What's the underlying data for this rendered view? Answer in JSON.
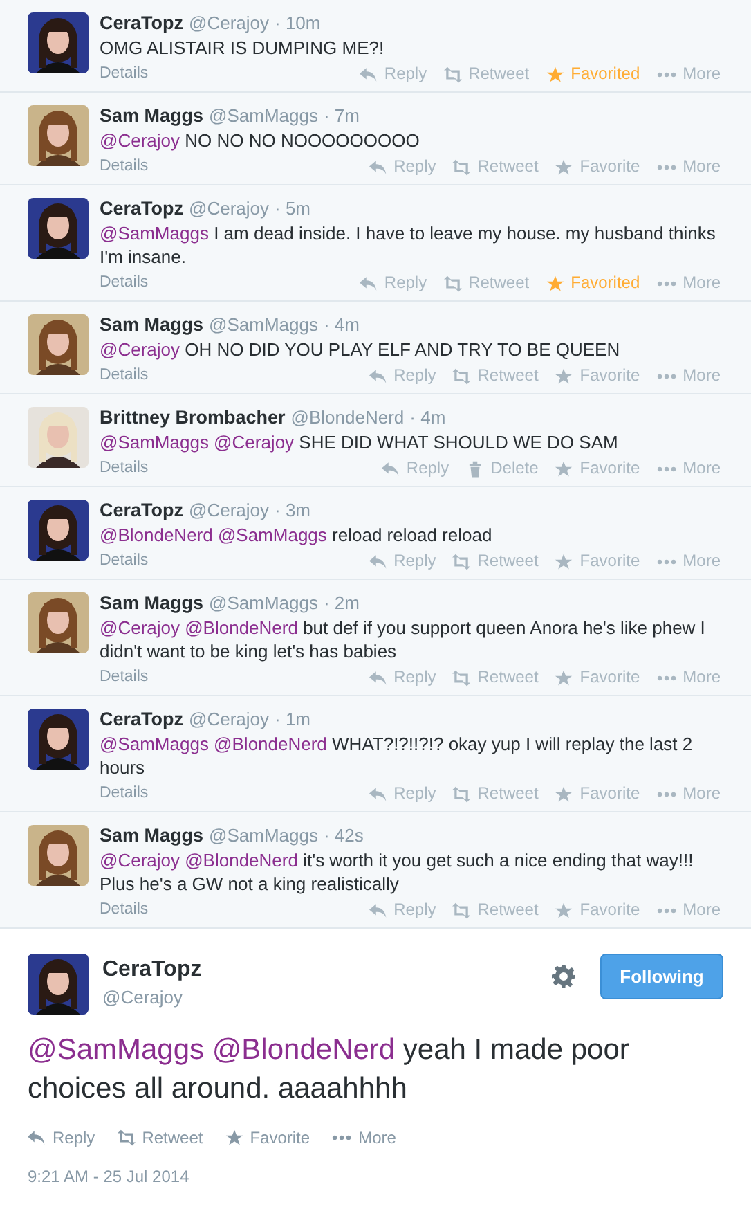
{
  "conversation": [
    {
      "name": "CeraTopz",
      "handle": "@Cerajoy",
      "time": "· 10m",
      "avatar": {
        "kind": "dark-hair"
      },
      "text": [
        {
          "kind": "plain",
          "text": "OMG ALISTAIR IS DUMPING ME?!"
        }
      ],
      "details": "Details",
      "actions": [
        {
          "kind": "reply",
          "label": "Reply",
          "on": false
        },
        {
          "kind": "retweet",
          "label": "Retweet",
          "on": false
        },
        {
          "kind": "favorite",
          "label": "Favorited",
          "on": true
        },
        {
          "kind": "more",
          "label": "More",
          "on": false
        }
      ]
    },
    {
      "name": "Sam Maggs",
      "handle": "@SamMaggs",
      "time": "· 7m",
      "avatar": {
        "kind": "brown-hair"
      },
      "text": [
        {
          "kind": "mention",
          "text": "@Cerajoy"
        },
        {
          "kind": "plain",
          "text": " NO NO NO NOOOOOOOOO"
        }
      ],
      "details": "Details",
      "actions": [
        {
          "kind": "reply",
          "label": "Reply",
          "on": false
        },
        {
          "kind": "retweet",
          "label": "Retweet",
          "on": false
        },
        {
          "kind": "favorite",
          "label": "Favorite",
          "on": false
        },
        {
          "kind": "more",
          "label": "More",
          "on": false
        }
      ]
    },
    {
      "name": "CeraTopz",
      "handle": "@Cerajoy",
      "time": "· 5m",
      "avatar": {
        "kind": "dark-hair"
      },
      "text": [
        {
          "kind": "mention",
          "text": "@SamMaggs"
        },
        {
          "kind": "plain",
          "text": " I am dead inside. I have to leave my house. my husband thinks I'm insane."
        }
      ],
      "details": "Details",
      "actions": [
        {
          "kind": "reply",
          "label": "Reply",
          "on": false
        },
        {
          "kind": "retweet",
          "label": "Retweet",
          "on": false
        },
        {
          "kind": "favorite",
          "label": "Favorited",
          "on": true
        },
        {
          "kind": "more",
          "label": "More",
          "on": false
        }
      ]
    },
    {
      "name": "Sam Maggs",
      "handle": "@SamMaggs",
      "time": "· 4m",
      "avatar": {
        "kind": "brown-hair"
      },
      "text": [
        {
          "kind": "mention",
          "text": "@Cerajoy"
        },
        {
          "kind": "plain",
          "text": " OH NO DID YOU PLAY ELF AND TRY TO BE QUEEN"
        }
      ],
      "details": "Details",
      "actions": [
        {
          "kind": "reply",
          "label": "Reply",
          "on": false
        },
        {
          "kind": "retweet",
          "label": "Retweet",
          "on": false
        },
        {
          "kind": "favorite",
          "label": "Favorite",
          "on": false
        },
        {
          "kind": "more",
          "label": "More",
          "on": false
        }
      ]
    },
    {
      "name": "Brittney Brombacher",
      "handle": "@BlondeNerd",
      "time": "· 4m",
      "avatar": {
        "kind": "blonde-hair"
      },
      "text": [
        {
          "kind": "mention",
          "text": "@SamMaggs @Cerajoy"
        },
        {
          "kind": "plain",
          "text": " SHE DID WHAT SHOULD WE DO SAM"
        }
      ],
      "details": "Details",
      "actions": [
        {
          "kind": "reply",
          "label": "Reply",
          "on": false
        },
        {
          "kind": "delete",
          "label": "Delete",
          "on": false
        },
        {
          "kind": "favorite",
          "label": "Favorite",
          "on": false
        },
        {
          "kind": "more",
          "label": "More",
          "on": false
        }
      ]
    },
    {
      "name": "CeraTopz",
      "handle": "@Cerajoy",
      "time": "· 3m",
      "avatar": {
        "kind": "dark-hair"
      },
      "text": [
        {
          "kind": "mention",
          "text": "@BlondeNerd @SamMaggs"
        },
        {
          "kind": "plain",
          "text": " reload reload reload"
        }
      ],
      "details": "Details",
      "actions": [
        {
          "kind": "reply",
          "label": "Reply",
          "on": false
        },
        {
          "kind": "retweet",
          "label": "Retweet",
          "on": false
        },
        {
          "kind": "favorite",
          "label": "Favorite",
          "on": false
        },
        {
          "kind": "more",
          "label": "More",
          "on": false
        }
      ]
    },
    {
      "name": "Sam Maggs",
      "handle": "@SamMaggs",
      "time": "· 2m",
      "avatar": {
        "kind": "brown-hair"
      },
      "text": [
        {
          "kind": "mention",
          "text": "@Cerajoy @BlondeNerd"
        },
        {
          "kind": "plain",
          "text": " but def if you support queen Anora he's like phew I didn't want to be king let's has babies"
        }
      ],
      "details": "Details",
      "actions": [
        {
          "kind": "reply",
          "label": "Reply",
          "on": false
        },
        {
          "kind": "retweet",
          "label": "Retweet",
          "on": false
        },
        {
          "kind": "favorite",
          "label": "Favorite",
          "on": false
        },
        {
          "kind": "more",
          "label": "More",
          "on": false
        }
      ]
    },
    {
      "name": "CeraTopz",
      "handle": "@Cerajoy",
      "time": "· 1m",
      "avatar": {
        "kind": "dark-hair"
      },
      "text": [
        {
          "kind": "mention",
          "text": "@SamMaggs @BlondeNerd"
        },
        {
          "kind": "plain",
          "text": " WHAT?!?!!?!? okay yup I will replay the last 2 hours"
        }
      ],
      "details": "Details",
      "actions": [
        {
          "kind": "reply",
          "label": "Reply",
          "on": false
        },
        {
          "kind": "retweet",
          "label": "Retweet",
          "on": false
        },
        {
          "kind": "favorite",
          "label": "Favorite",
          "on": false
        },
        {
          "kind": "more",
          "label": "More",
          "on": false
        }
      ]
    },
    {
      "name": "Sam Maggs",
      "handle": "@SamMaggs",
      "time": "· 42s",
      "avatar": {
        "kind": "brown-hair"
      },
      "text": [
        {
          "kind": "mention",
          "text": "@Cerajoy @BlondeNerd"
        },
        {
          "kind": "plain",
          "text": " it's worth it you get such a nice ending that way!!! Plus he's a GW not a king realistically"
        }
      ],
      "details": "Details",
      "actions": [
        {
          "kind": "reply",
          "label": "Reply",
          "on": false
        },
        {
          "kind": "retweet",
          "label": "Retweet",
          "on": false
        },
        {
          "kind": "favorite",
          "label": "Favorite",
          "on": false
        },
        {
          "kind": "more",
          "label": "More",
          "on": false
        }
      ]
    }
  ],
  "main_tweet": {
    "name": "CeraTopz",
    "handle": "@Cerajoy",
    "avatar": {
      "kind": "dark-hair"
    },
    "follow_button": {
      "label": "Following",
      "selected": true
    },
    "text": [
      {
        "kind": "mention",
        "text": "@SamMaggs @BlondeNerd"
      },
      {
        "kind": "plain",
        "text": " yeah I made poor choices all around. aaaahhhh"
      }
    ],
    "actions": [
      {
        "kind": "reply",
        "label": "Reply",
        "on": false
      },
      {
        "kind": "retweet",
        "label": "Retweet",
        "on": false
      },
      {
        "kind": "favorite",
        "label": "Favorite",
        "on": false
      },
      {
        "kind": "more",
        "label": "More",
        "on": false
      }
    ],
    "timestamp": "9:21 AM - 25 Jul 2014"
  }
}
